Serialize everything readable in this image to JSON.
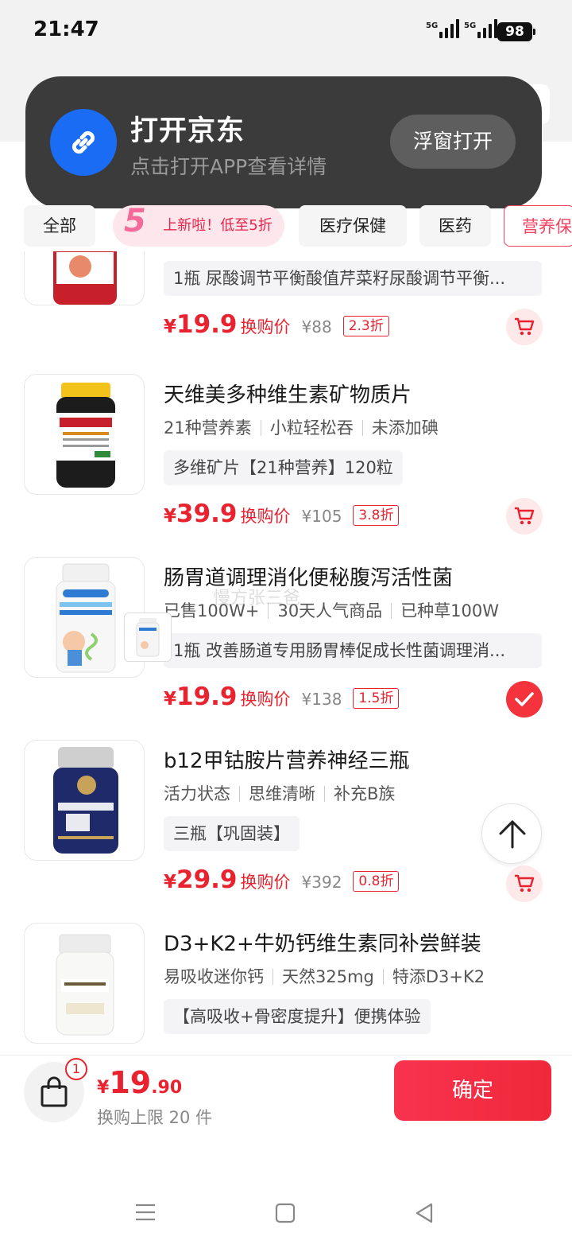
{
  "status_bar": {
    "time": "21:47",
    "signal1_label": "5G",
    "signal2_label": "5G",
    "battery": "98"
  },
  "toast": {
    "title": "打开京东",
    "subtitle": "点击打开APP查看详情",
    "button": "浮窗打开",
    "icon": "link-icon",
    "accent": "#1a6cf5"
  },
  "tabs": [
    {
      "label": "全部"
    },
    {
      "label": "上新啦！低至5折",
      "badge": "5"
    },
    {
      "label": "医疗保健"
    },
    {
      "label": "医药"
    },
    {
      "label": "营养保健"
    }
  ],
  "products": [
    {
      "name": "",
      "tags": [],
      "spec": "1瓶 尿酸调节平衡酸值芹菜籽尿酸调节平衡...",
      "price": "19.9",
      "price_label": "换购价",
      "original_price": "¥88",
      "discount": "2.3折",
      "selected": false
    },
    {
      "name": "天维美多种维生素矿物质片",
      "tags": [
        "21种营养素",
        "小粒轻松吞",
        "未添加碘"
      ],
      "spec": "多维矿片【21种营养】120粒",
      "price": "39.9",
      "price_label": "换购价",
      "original_price": "¥105",
      "discount": "3.8折",
      "selected": false
    },
    {
      "name": "肠胃道调理消化便秘腹泻活性菌",
      "tags": [
        "已售100W+",
        "30天人气商品",
        "已种草100W"
      ],
      "spec": "1瓶 改善肠道专用肠胃棒促成长性菌调理消...",
      "price": "19.9",
      "price_label": "换购价",
      "original_price": "¥138",
      "discount": "1.5折",
      "selected": true
    },
    {
      "name": "b12甲钴胺片营养神经三瓶",
      "tags": [
        "活力状态",
        "思维清晰",
        "补充B族"
      ],
      "spec": "三瓶【巩固装】",
      "price": "29.9",
      "price_label": "换购价",
      "original_price": "¥392",
      "discount": "0.8折",
      "selected": false
    },
    {
      "name": "D3+K2+牛奶钙维生素同补尝鲜装",
      "tags": [
        "易吸收迷你钙",
        "天然325mg",
        "特添D3+K2"
      ],
      "spec": "【高吸收+骨密度提升】便携体验",
      "price": "",
      "price_label": "",
      "original_price": "",
      "discount": "",
      "selected": false
    }
  ],
  "watermark": "慢方张三爸",
  "bottom_bar": {
    "cart_count": "1",
    "currency": "¥",
    "total_int": "19",
    "total_dec": ".90",
    "limit_text": "换购上限 20 件",
    "confirm_label": "确定"
  },
  "colors": {
    "price_red": "#e8232f",
    "confirm_red": "#f8334e",
    "toast_bg": "#3b3b3b"
  }
}
